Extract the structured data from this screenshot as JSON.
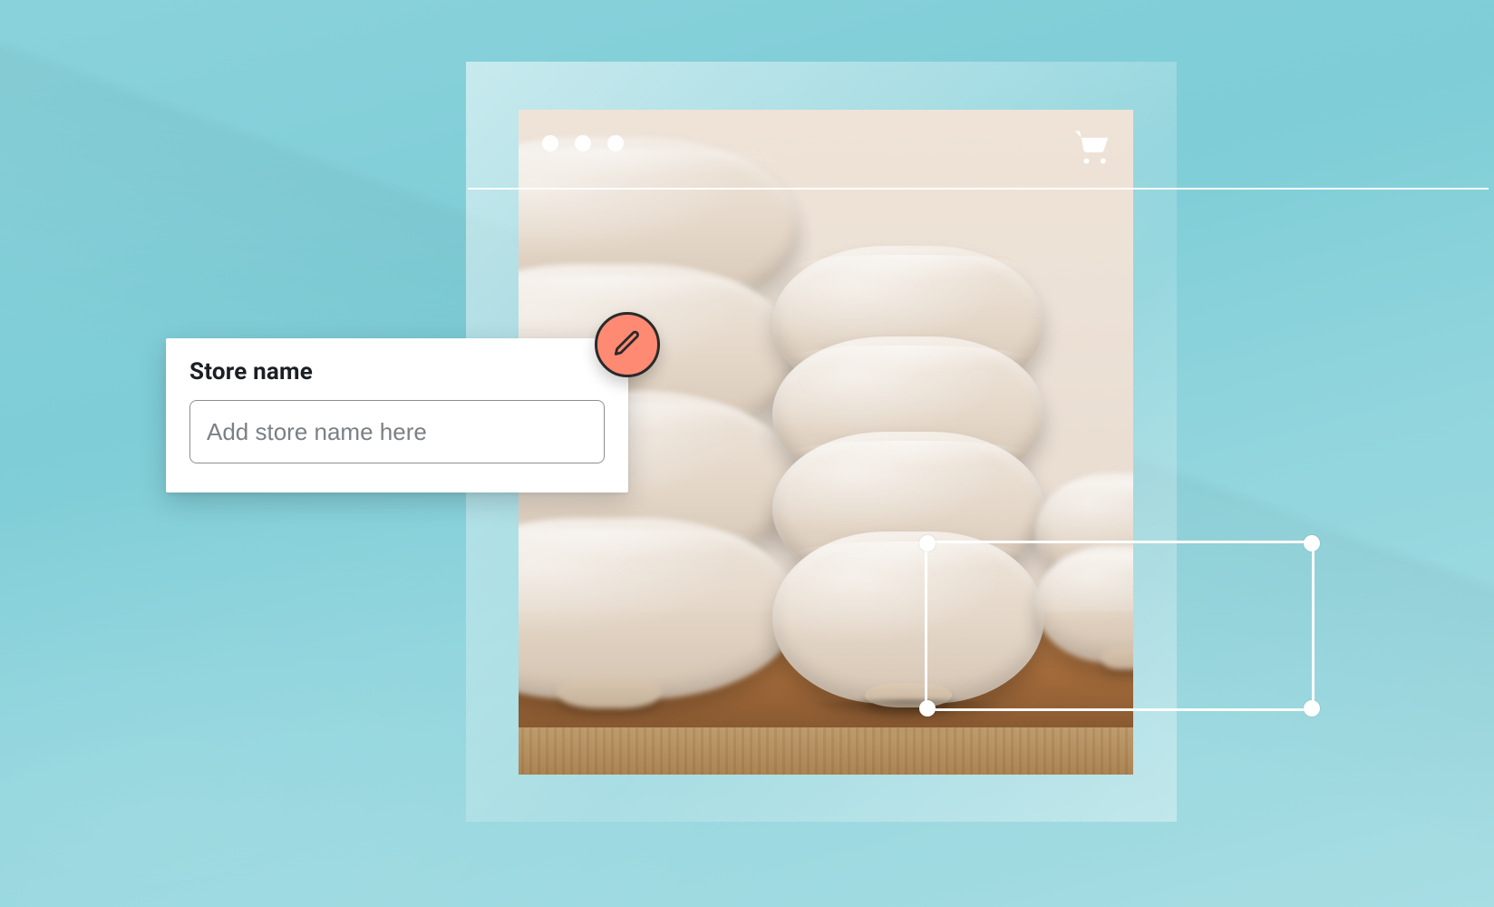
{
  "card": {
    "title": "Store name",
    "placeholder": "Add store name here",
    "value": ""
  },
  "colors": {
    "accent": "#ff8a73",
    "ink": "#1b1f23",
    "teal": "#84d0da"
  },
  "icons": {
    "pencil": "pencil-icon",
    "cart": "cart-icon",
    "window_dot": "window-dot"
  }
}
